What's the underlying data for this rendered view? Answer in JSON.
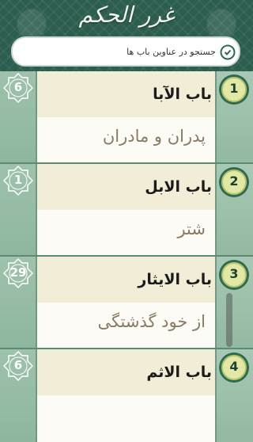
{
  "header": {
    "logo_text": "غرر الحکم"
  },
  "search": {
    "placeholder": "جستجو در عناوین باب ها",
    "icon": "search-icon"
  },
  "items": [
    {
      "number": "1",
      "count": "6",
      "title": "باب الآبا",
      "subtitle": "پدران و مادران"
    },
    {
      "number": "2",
      "count": "1",
      "title": "باب الابل",
      "subtitle": "شتر"
    },
    {
      "number": "3",
      "count": "29",
      "title": "باب الایثار",
      "subtitle": "از خود گذشتگی"
    },
    {
      "number": "4",
      "count": "6",
      "title": "باب الاثم",
      "subtitle": ""
    }
  ]
}
